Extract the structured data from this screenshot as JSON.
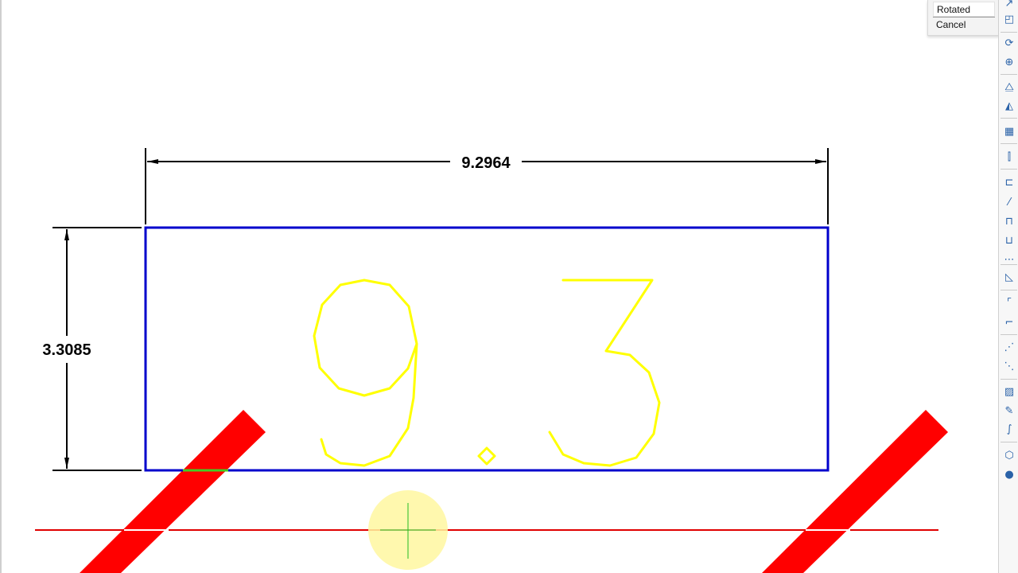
{
  "context_menu": {
    "items": [
      "Rotated",
      "Cancel"
    ]
  },
  "drawing": {
    "horizontal_dimension": "9.2964",
    "vertical_dimension": "3.3085",
    "text_entity": "9.3",
    "colors": {
      "dimension": "#000000",
      "rectangle": "#0000cc",
      "text": "#ffff00",
      "hatch_bars": "#ff0000",
      "construction_line": "#e00000",
      "cursor_highlight": "#fff7a0"
    }
  },
  "toolbar": {
    "icons": [
      "draw-order-icon",
      "scale-icon",
      "rotate-icon",
      "orbit-icon",
      "mirror-icon",
      "mirror-3d-icon",
      "array-icon",
      "align-icon",
      "stretch-icon",
      "trim-icon",
      "break-icon",
      "join-icon",
      "extend-icon",
      "chamfer-icon",
      "fillet-icon",
      "fillet-corner-icon",
      "measure-icon",
      "divide-icon",
      "hatch-icon",
      "edit-hatch-icon",
      "spline-icon",
      "3d-box-icon",
      "sphere-icon"
    ]
  }
}
